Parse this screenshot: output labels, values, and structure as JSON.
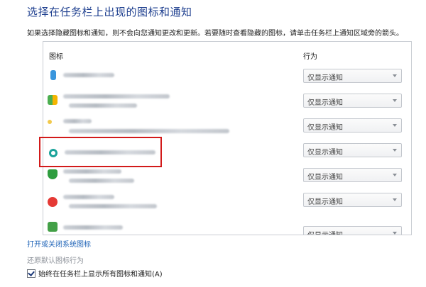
{
  "title": "选择在任务栏上出现的图标和通知",
  "description": "如果选择隐藏图标和通知，则不会向您通知更改和更新。若要随时查看隐藏的图标，请单击任务栏上通知区域旁的箭头。",
  "table": {
    "icon_header": "图标",
    "behavior_header": "行为",
    "rows": [
      {
        "behavior": "仅显示通知",
        "icon": "blue-bars-icon",
        "color": "#3a96dd"
      },
      {
        "behavior": "仅显示通知",
        "icon": "colorful-grid-icon",
        "color": "#4caf50"
      },
      {
        "behavior": "仅显示通知",
        "icon": "yellow-folder-icon",
        "color": "#f2c94c"
      },
      {
        "behavior": "仅显示通知",
        "icon": "green-sync-icon",
        "color": "#1aa39a"
      },
      {
        "behavior": "仅显示通知",
        "icon": "green-shield-icon",
        "color": "#2e9d3f"
      },
      {
        "behavior": "仅显示通知",
        "icon": "red-music-icon",
        "color": "#e53935"
      },
      {
        "behavior": "仅显示通知",
        "icon": "green-app-icon",
        "color": "#43a047"
      }
    ]
  },
  "links": {
    "system_icons": "打开或关闭系统图标",
    "restore_defaults": "还原默认图标行为"
  },
  "checkbox": {
    "label": "始终在任务栏上显示所有图标和通知(A)",
    "checked": true
  },
  "colors": {
    "title": "#1e3f8f",
    "link": "#1e63b7",
    "highlight": "#d21a1a"
  }
}
